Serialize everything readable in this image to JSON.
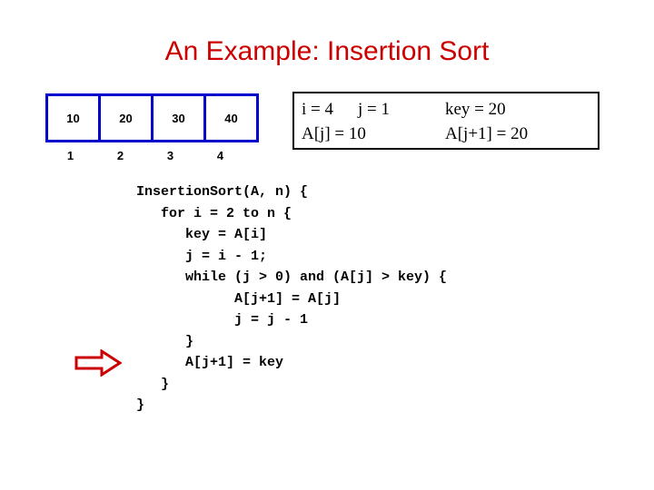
{
  "slide": {
    "title": "An Example: Insertion Sort"
  },
  "array": {
    "values": [
      "10",
      "20",
      "30",
      "40"
    ],
    "indices": [
      "1",
      "2",
      "3",
      "4"
    ]
  },
  "status": {
    "line1": {
      "i": "i = 4",
      "j": "j = 1",
      "key": "key = 20"
    },
    "line2": {
      "aj": "A[j] = 10",
      "ajp1": "A[j+1] = 20"
    }
  },
  "code": {
    "lines": [
      "InsertionSort(A, n) {",
      "   for i = 2 to n {",
      "      key = A[i]",
      "      j = i - 1;",
      "      while (j > 0) and (A[j] > key) {",
      "            A[j+1] = A[j]",
      "            j = j - 1",
      "      }",
      "      A[j+1] = key",
      "   }",
      "}"
    ],
    "text": "InsertionSort(A, n) {\n   for i = 2 to n {\n      key = A[i]\n      j = i - 1;\n      while (j > 0) and (A[j] > key) {\n            A[j+1] = A[j]\n            j = j - 1\n      }\n      A[j+1] = key\n   }\n}"
  },
  "colors": {
    "title": "#cc0000",
    "array_border": "#0000cc",
    "arrow": "#cc0000",
    "status_border": "#000000",
    "text": "#000000"
  }
}
